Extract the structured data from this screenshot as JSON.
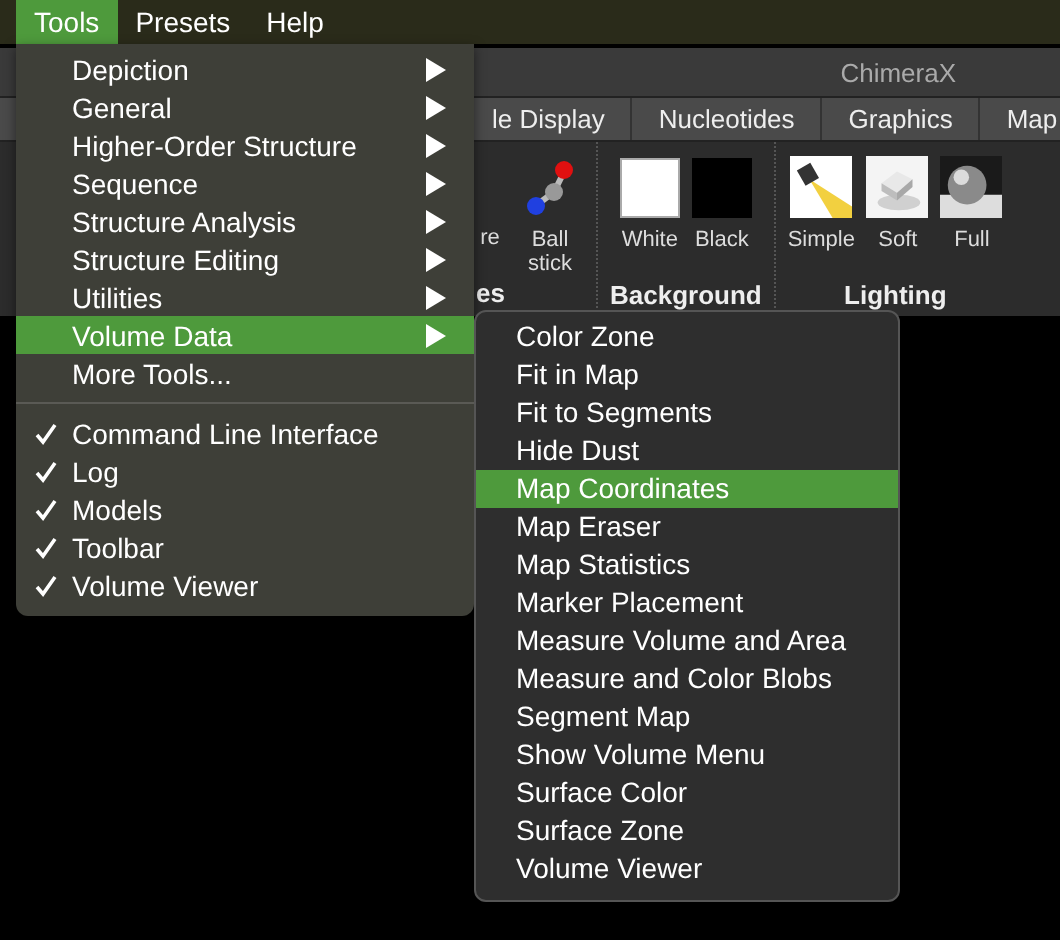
{
  "menubar": [
    {
      "label": "Tools",
      "selected": true
    },
    {
      "label": "Presets",
      "selected": false
    },
    {
      "label": "Help",
      "selected": false
    }
  ],
  "window": {
    "title": "ChimeraX"
  },
  "tabs": [
    {
      "label": "le Display",
      "selected": false
    },
    {
      "label": "Nucleotides",
      "selected": false
    },
    {
      "label": "Graphics",
      "selected": false
    },
    {
      "label": "Map",
      "selected": false
    }
  ],
  "toolbar": {
    "fragment_label": "re",
    "fragment_group": "es",
    "buttons": [
      {
        "kind": "ballstick",
        "label": "Ball stick"
      }
    ],
    "groups": [
      {
        "label": "Background",
        "buttons": [
          {
            "kind": "white",
            "label": "White"
          },
          {
            "kind": "black",
            "label": "Black"
          }
        ]
      },
      {
        "label": "Lighting",
        "buttons": [
          {
            "kind": "simple",
            "label": "Simple"
          },
          {
            "kind": "soft",
            "label": "Soft"
          },
          {
            "kind": "full",
            "label": "Full"
          }
        ]
      }
    ]
  },
  "tools_menu": [
    {
      "kind": "submenu",
      "label": "Depiction",
      "selected": false
    },
    {
      "kind": "submenu",
      "label": "General",
      "selected": false
    },
    {
      "kind": "submenu",
      "label": "Higher-Order Structure",
      "selected": false
    },
    {
      "kind": "submenu",
      "label": "Sequence",
      "selected": false
    },
    {
      "kind": "submenu",
      "label": "Structure Analysis",
      "selected": false
    },
    {
      "kind": "submenu",
      "label": "Structure Editing",
      "selected": false
    },
    {
      "kind": "submenu",
      "label": "Utilities",
      "selected": false
    },
    {
      "kind": "submenu",
      "label": "Volume Data",
      "selected": true
    },
    {
      "kind": "action",
      "label": "More Tools...",
      "selected": false
    },
    {
      "kind": "separator"
    },
    {
      "kind": "toggle",
      "label": "Command Line Interface",
      "checked": true,
      "selected": false
    },
    {
      "kind": "toggle",
      "label": "Log",
      "checked": true,
      "selected": false
    },
    {
      "kind": "toggle",
      "label": "Models",
      "checked": true,
      "selected": false
    },
    {
      "kind": "toggle",
      "label": "Toolbar",
      "checked": true,
      "selected": false
    },
    {
      "kind": "toggle",
      "label": "Volume Viewer",
      "checked": true,
      "selected": false
    }
  ],
  "volume_data_menu": [
    {
      "label": "Color Zone",
      "selected": false
    },
    {
      "label": "Fit in Map",
      "selected": false
    },
    {
      "label": "Fit to Segments",
      "selected": false
    },
    {
      "label": "Hide Dust",
      "selected": false
    },
    {
      "label": "Map Coordinates",
      "selected": true
    },
    {
      "label": "Map Eraser",
      "selected": false
    },
    {
      "label": "Map Statistics",
      "selected": false
    },
    {
      "label": "Marker Placement",
      "selected": false
    },
    {
      "label": "Measure Volume and Area",
      "selected": false
    },
    {
      "label": "Measure and Color Blobs",
      "selected": false
    },
    {
      "label": "Segment Map",
      "selected": false
    },
    {
      "label": "Show Volume Menu",
      "selected": false
    },
    {
      "label": "Surface Color",
      "selected": false
    },
    {
      "label": "Surface Zone",
      "selected": false
    },
    {
      "label": "Volume Viewer",
      "selected": false
    }
  ]
}
